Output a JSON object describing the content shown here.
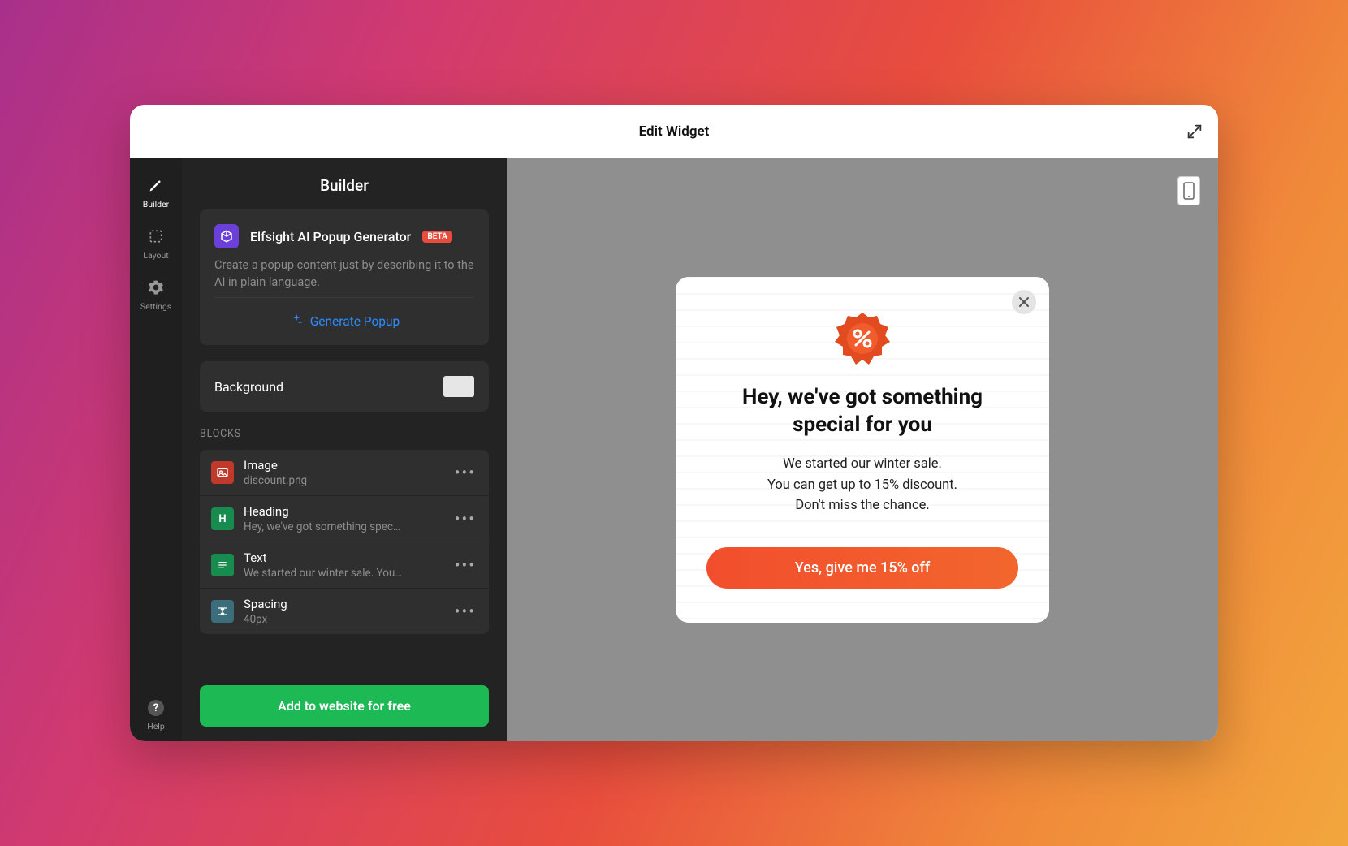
{
  "titlebar": {
    "title": "Edit Widget"
  },
  "rail": {
    "items": [
      {
        "label": "Builder"
      },
      {
        "label": "Layout"
      },
      {
        "label": "Settings"
      }
    ],
    "help": "Help"
  },
  "panel": {
    "heading": "Builder",
    "ai": {
      "title": "Elfsight AI Popup Generator",
      "badge": "BETA",
      "sub": "Create a popup content just by describing it to the AI in plain language.",
      "button": "Generate Popup"
    },
    "background": {
      "label": "Background",
      "color": "#e6e6e6"
    },
    "blocks_label": "BLOCKS",
    "blocks": [
      {
        "type": "Image",
        "sub": "discount.png",
        "icon_bg": "#c0392b",
        "icon_glyph": "img"
      },
      {
        "type": "Heading",
        "sub": "Hey, we've got something spec…",
        "icon_bg": "#188c4e",
        "icon_glyph": "H"
      },
      {
        "type": "Text",
        "sub": "We started our winter sale. You…",
        "icon_bg": "#188c4e",
        "icon_glyph": "T"
      },
      {
        "type": "Spacing",
        "sub": "40px",
        "icon_bg": "#3b6d7a",
        "icon_glyph": "sp"
      }
    ],
    "cta": "Add to website for free"
  },
  "popup": {
    "heading": "Hey, we've got something special for you",
    "text": "We started our winter sale.\nYou can get up to 15% discount.\nDon't miss the chance.",
    "button": "Yes, give me 15% off"
  }
}
